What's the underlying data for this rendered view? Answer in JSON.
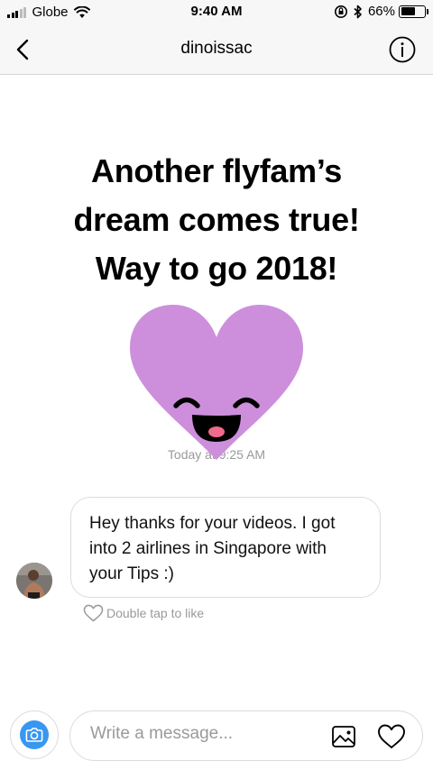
{
  "status_bar": {
    "carrier": "Globe",
    "time": "9:40 AM",
    "battery": "66%",
    "battery_level": 0.66
  },
  "header": {
    "title": "dinoissac"
  },
  "story": {
    "line1": "Another flyfam’s",
    "line2": "dream comes true!",
    "line3": "Way to go 2018!",
    "sticker_icon": "smiling-heart-sticker",
    "sticker_color": "#cd8fdc"
  },
  "timestamp": "Today at 9:25 AM",
  "message": {
    "text": "Hey thanks for your videos. I got into 2 airlines in Singapore with your Tips :)",
    "like_hint": "Double tap to like"
  },
  "composer": {
    "placeholder": "Write a message...",
    "camera_color": "#3897f0"
  }
}
